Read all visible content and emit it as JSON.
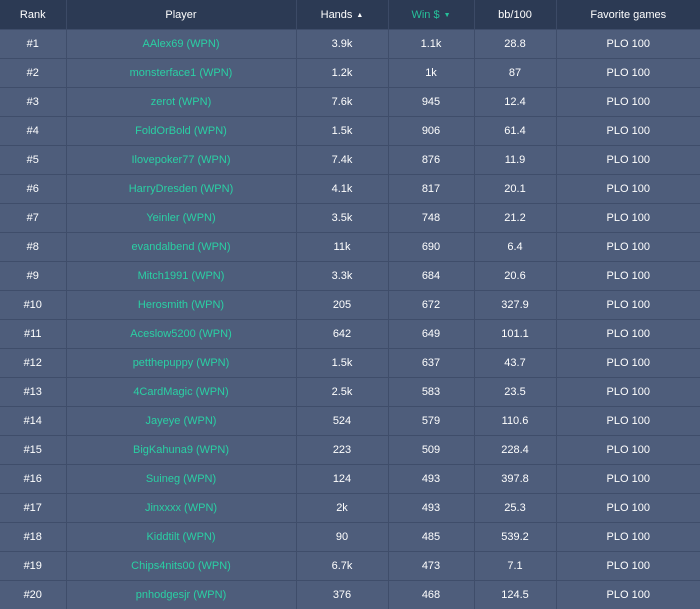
{
  "columns": {
    "rank": "Rank",
    "player": "Player",
    "hands": "Hands",
    "win": "Win $",
    "bb100": "bb/100",
    "favorite": "Favorite games"
  },
  "sort_icons": {
    "hands": "▲",
    "win": "▼"
  },
  "colors": {
    "header_bg": "#2c3a54",
    "row_bg": "#4e5d7b",
    "accent": "#26c09a",
    "player_link": "#2ad0a4"
  },
  "rows": [
    {
      "rank": "#1",
      "player": "AAlex69 (WPN)",
      "hands": "3.9k",
      "win": "1.1k",
      "bb100": "28.8",
      "favorite": "PLO 100"
    },
    {
      "rank": "#2",
      "player": "monsterface1 (WPN)",
      "hands": "1.2k",
      "win": "1k",
      "bb100": "87",
      "favorite": "PLO 100"
    },
    {
      "rank": "#3",
      "player": "zerot (WPN)",
      "hands": "7.6k",
      "win": "945",
      "bb100": "12.4",
      "favorite": "PLO 100"
    },
    {
      "rank": "#4",
      "player": "FoldOrBold (WPN)",
      "hands": "1.5k",
      "win": "906",
      "bb100": "61.4",
      "favorite": "PLO 100"
    },
    {
      "rank": "#5",
      "player": "Ilovepoker77 (WPN)",
      "hands": "7.4k",
      "win": "876",
      "bb100": "11.9",
      "favorite": "PLO 100"
    },
    {
      "rank": "#6",
      "player": "HarryDresden (WPN)",
      "hands": "4.1k",
      "win": "817",
      "bb100": "20.1",
      "favorite": "PLO 100"
    },
    {
      "rank": "#7",
      "player": "Yeinler (WPN)",
      "hands": "3.5k",
      "win": "748",
      "bb100": "21.2",
      "favorite": "PLO 100"
    },
    {
      "rank": "#8",
      "player": "evandalbend (WPN)",
      "hands": "11k",
      "win": "690",
      "bb100": "6.4",
      "favorite": "PLO 100"
    },
    {
      "rank": "#9",
      "player": "Mitch1991 (WPN)",
      "hands": "3.3k",
      "win": "684",
      "bb100": "20.6",
      "favorite": "PLO 100"
    },
    {
      "rank": "#10",
      "player": "Herosmith (WPN)",
      "hands": "205",
      "win": "672",
      "bb100": "327.9",
      "favorite": "PLO 100"
    },
    {
      "rank": "#11",
      "player": "Aceslow5200 (WPN)",
      "hands": "642",
      "win": "649",
      "bb100": "101.1",
      "favorite": "PLO 100"
    },
    {
      "rank": "#12",
      "player": "petthepuppy (WPN)",
      "hands": "1.5k",
      "win": "637",
      "bb100": "43.7",
      "favorite": "PLO 100"
    },
    {
      "rank": "#13",
      "player": "4CardMagic (WPN)",
      "hands": "2.5k",
      "win": "583",
      "bb100": "23.5",
      "favorite": "PLO 100"
    },
    {
      "rank": "#14",
      "player": "Jayeye (WPN)",
      "hands": "524",
      "win": "579",
      "bb100": "110.6",
      "favorite": "PLO 100"
    },
    {
      "rank": "#15",
      "player": "BigKahuna9 (WPN)",
      "hands": "223",
      "win": "509",
      "bb100": "228.4",
      "favorite": "PLO 100"
    },
    {
      "rank": "#16",
      "player": "Suineg (WPN)",
      "hands": "124",
      "win": "493",
      "bb100": "397.8",
      "favorite": "PLO 100"
    },
    {
      "rank": "#17",
      "player": "Jinxxxx (WPN)",
      "hands": "2k",
      "win": "493",
      "bb100": "25.3",
      "favorite": "PLO 100"
    },
    {
      "rank": "#18",
      "player": "Kiddtilt (WPN)",
      "hands": "90",
      "win": "485",
      "bb100": "539.2",
      "favorite": "PLO 100"
    },
    {
      "rank": "#19",
      "player": "Chips4nits00 (WPN)",
      "hands": "6.7k",
      "win": "473",
      "bb100": "7.1",
      "favorite": "PLO 100"
    },
    {
      "rank": "#20",
      "player": "pnhodgesjr (WPN)",
      "hands": "376",
      "win": "468",
      "bb100": "124.5",
      "favorite": "PLO 100"
    }
  ]
}
